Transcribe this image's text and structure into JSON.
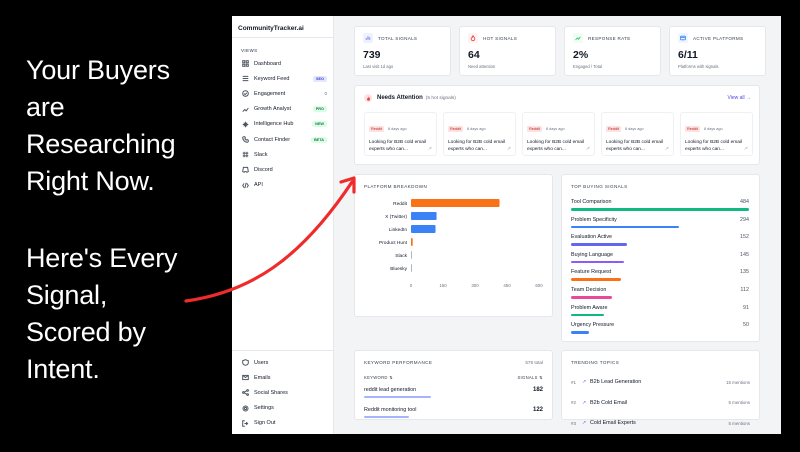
{
  "headline": {
    "top": [
      "Your Buyers",
      "are",
      "Researching",
      "Right Now."
    ],
    "bottom": [
      "Here's Every",
      "Signal,",
      "Scored by",
      "Intent."
    ]
  },
  "app": {
    "brand": "CommunityTracker.ai",
    "views_label": "VIEWS",
    "nav": [
      {
        "label": "Dashboard",
        "icon": "dashboard-icon",
        "badge": "",
        "count": ""
      },
      {
        "label": "Keyword Feed",
        "icon": "list-icon",
        "badge": "SEO",
        "count": ""
      },
      {
        "label": "Engagement",
        "icon": "check-circle-icon",
        "badge": "",
        "count": "0"
      },
      {
        "label": "Growth Analyst",
        "icon": "trend-icon",
        "badge": "PRO",
        "count": ""
      },
      {
        "label": "Intelligence Hub",
        "icon": "sparkle-icon",
        "badge": "NEW",
        "count": ""
      },
      {
        "label": "Contact Finder",
        "icon": "phone-icon",
        "badge": "BETA",
        "count": ""
      },
      {
        "label": "Slack",
        "icon": "slack-icon",
        "badge": "",
        "count": ""
      },
      {
        "label": "Discord",
        "icon": "discord-icon",
        "badge": "",
        "count": ""
      },
      {
        "label": "API",
        "icon": "code-icon",
        "badge": "",
        "count": ""
      }
    ],
    "nav_bottom": [
      {
        "label": "Users",
        "icon": "shield-icon"
      },
      {
        "label": "Emails",
        "icon": "mail-icon"
      },
      {
        "label": "Social Shares",
        "icon": "share-icon"
      },
      {
        "label": "Settings",
        "icon": "gear-icon"
      },
      {
        "label": "Sign Out",
        "icon": "logout-icon"
      }
    ],
    "stats": [
      {
        "label": "TOTAL SIGNALS",
        "value": "739",
        "sub": "Last visit 1d ago",
        "color": "#6366f1",
        "bg": "#eef2ff"
      },
      {
        "label": "HOT SIGNALS",
        "value": "64",
        "sub": "Need attention",
        "color": "#ef4444",
        "bg": "#fef2f2"
      },
      {
        "label": "RESPONSE RATE",
        "value": "2%",
        "sub": "Engaged / Total",
        "color": "#22c55e",
        "bg": "#f0fdf4"
      },
      {
        "label": "ACTIVE PLATFORMS",
        "value": "6/11",
        "sub": "Platforms with signals",
        "color": "#3b82f6",
        "bg": "#eff6ff"
      }
    ],
    "attention": {
      "title": "Needs Attention",
      "sub": "(5 hot signals)",
      "view_all": "View all →",
      "cards": [
        {
          "tag": "Reddit",
          "ago": "8 days ago",
          "text": "Looking for B2B cold email experts who can..."
        },
        {
          "tag": "Reddit",
          "ago": "8 days ago",
          "text": "Looking for B2B cold email experts who can..."
        },
        {
          "tag": "Reddit",
          "ago": "8 days ago",
          "text": "Looking for B2B cold email experts who can..."
        },
        {
          "tag": "Reddit",
          "ago": "8 days ago",
          "text": "Looking for B2B cold email experts who can..."
        },
        {
          "tag": "Reddit",
          "ago": "8 days ago",
          "text": "Looking for B2B cold email experts who can..."
        }
      ]
    },
    "platform_title": "PLATFORM BREAKDOWN",
    "signals_title": "TOP BUYING SIGNALS",
    "top_signals": [
      {
        "name": "Tool Comparison",
        "value": 484,
        "color": "#10b981"
      },
      {
        "name": "Problem Specificity",
        "value": 294,
        "color": "#3b82f6"
      },
      {
        "name": "Evaluation Active",
        "value": 152,
        "color": "#6366f1"
      },
      {
        "name": "Buying Language",
        "value": 145,
        "color": "#8b5cf6"
      },
      {
        "name": "Feature Request",
        "value": 135,
        "color": "#f97316"
      },
      {
        "name": "Team Decision",
        "value": 112,
        "color": "#ec4899"
      },
      {
        "name": "Problem Aware",
        "value": 91,
        "color": "#10b981"
      },
      {
        "name": "Urgency Pressure",
        "value": 50,
        "color": "#3b82f6"
      }
    ],
    "keyword": {
      "title": "KEYWORD PERFORMANCE",
      "total": "578 total",
      "col_keyword": "KEYWORD ⇅",
      "col_signals": "SIGNALS ⇅",
      "rows": [
        {
          "name": "reddit lead generation",
          "value": "182",
          "pct": 0.75
        },
        {
          "name": "Reddit monitoring tool",
          "value": "122",
          "pct": 0.5
        }
      ]
    },
    "trending": {
      "title": "TRENDING TOPICS",
      "rows": [
        {
          "rank": "#1",
          "name": "B2b Lead Generation",
          "count": "15 mentions"
        },
        {
          "rank": "#2",
          "name": "B2b Cold Email",
          "count": "5 mentions"
        },
        {
          "rank": "#3",
          "name": "Cold Email Experts",
          "count": "5 mentions"
        }
      ]
    }
  },
  "chart_data": {
    "type": "bar",
    "orientation": "horizontal",
    "categories": [
      "Reddit",
      "X (Twitter)",
      "LinkedIn",
      "Product Hunt",
      "Slack",
      "Bluesky"
    ],
    "values": [
      415,
      120,
      115,
      8,
      2,
      1
    ],
    "colors": [
      "#f97316",
      "#3b82f6",
      "#3b82f6",
      "#f97316",
      "#9ca3af",
      "#9ca3af"
    ],
    "xlim": [
      0,
      600
    ],
    "xticks": [
      "0",
      "150",
      "300",
      "450",
      "600"
    ]
  }
}
